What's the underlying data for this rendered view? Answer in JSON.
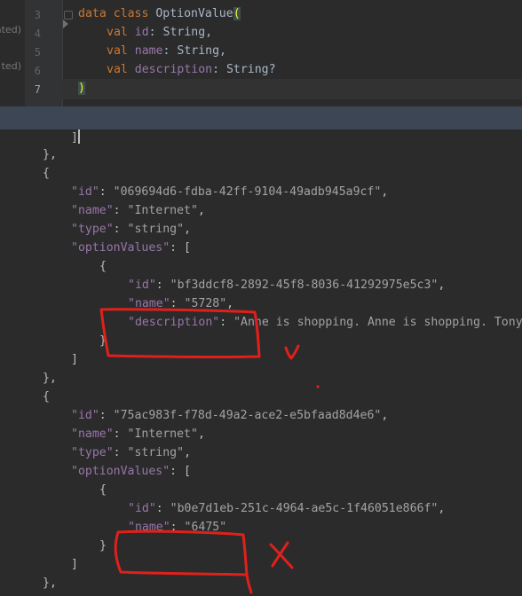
{
  "editor": {
    "side_labels": [
      "ated)",
      "ted)"
    ],
    "line_numbers": [
      "3",
      "4",
      "5",
      "6",
      "7"
    ],
    "code": {
      "l3_kw": "data class ",
      "l3_name": "OptionValue",
      "l3_paren": "(",
      "l4_val": "val ",
      "l4_param": "id",
      "l4_type": ": String,",
      "l5_val": "val ",
      "l5_param": "name",
      "l5_type": ": String,",
      "l6_val": "val ",
      "l6_param": "description",
      "l6_type": ": String?",
      "l7_paren": ")"
    }
  },
  "json": {
    "close_bracket": "]",
    "close_obj": "},",
    "open_obj": "{",
    "open_arr": "[",
    "item1": {
      "id_key": "\"id\"",
      "id_val": "\"069694d6-fdba-42ff-9104-49adb945a9cf\"",
      "name_key": "\"name\"",
      "name_val": "\"Internet\"",
      "type_key": "\"type\"",
      "type_val": "\"string\"",
      "opts_key": "\"optionValues\"",
      "opt": {
        "id_key": "\"id\"",
        "id_val": "\"bf3ddcf8-2892-45f8-8036-41292975e5c3\"",
        "name_key": "\"name\"",
        "name_val": "\"5728\"",
        "desc_key": "\"description\"",
        "desc_val": "\"Anne is shopping. Anne is shopping. Tony"
      }
    },
    "item2": {
      "id_key": "\"id\"",
      "id_val": "\"75ac983f-f78d-49a2-ace2-e5bfaad8d4e6\"",
      "name_key": "\"name\"",
      "name_val": "\"Internet\"",
      "type_key": "\"type\"",
      "type_val": "\"string\"",
      "opts_key": "\"optionValues\"",
      "opt": {
        "id_key": "\"id\"",
        "id_val": "\"b0e7d1eb-251c-4964-ae5c-1f46051e866f\"",
        "name_key": "\"name\"",
        "name_val": "\"6475\""
      }
    }
  },
  "annotations": {
    "check_mark": "checkmark",
    "cross_mark": "x-mark",
    "color": "#e0201b"
  }
}
